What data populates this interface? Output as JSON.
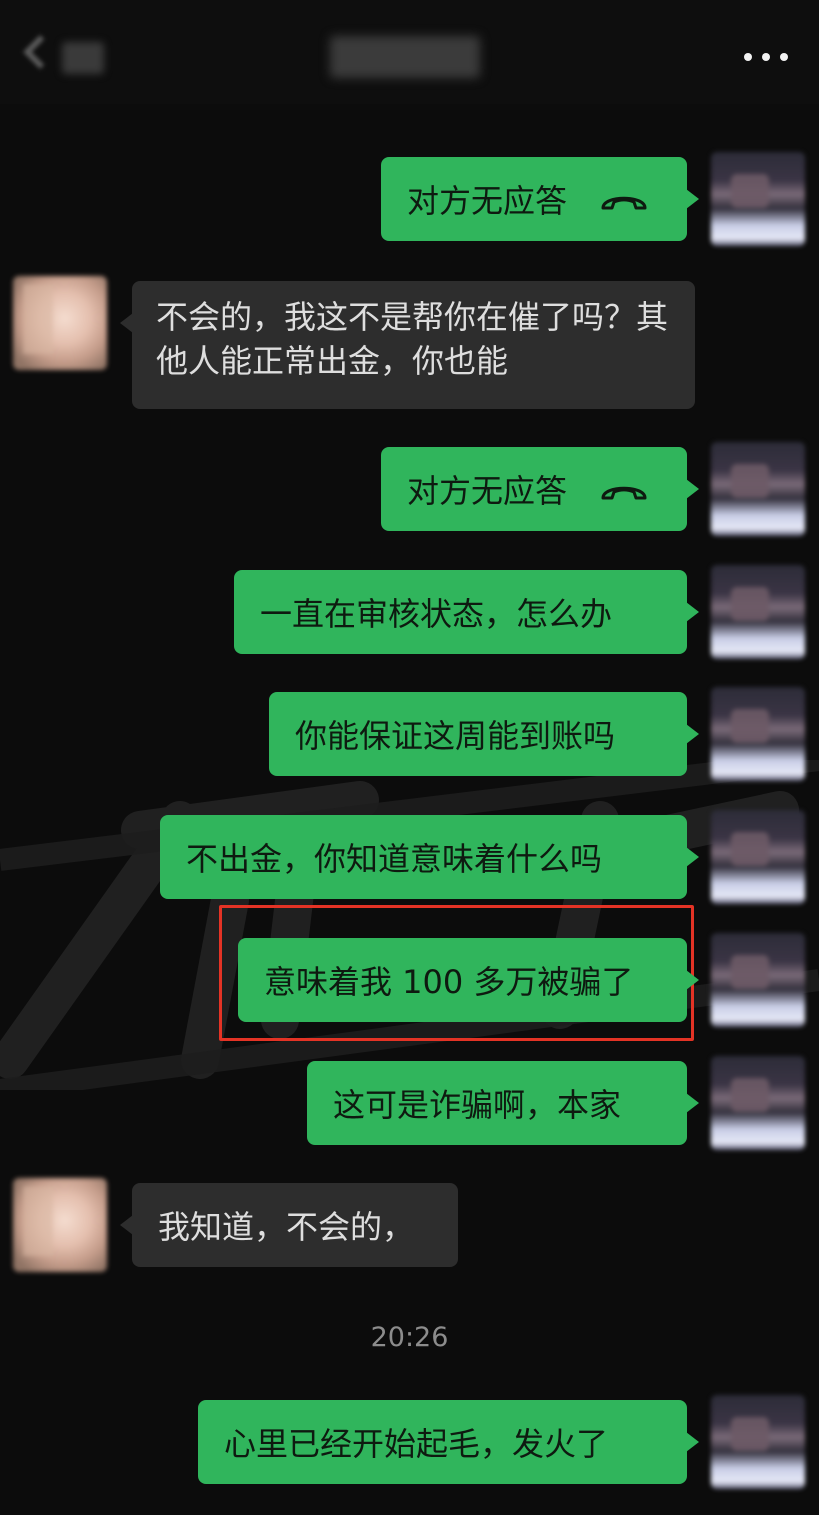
{
  "header": {
    "back_label": "<",
    "more_icon": "more-dots-icon"
  },
  "messages": [
    {
      "id": "m1",
      "side": "sent",
      "text": "对方无应答",
      "icon": "hang-up-phone-icon"
    },
    {
      "id": "m2",
      "side": "received",
      "text": "不会的，我这不是帮你在催了吗？其他人能正常出金，你也能"
    },
    {
      "id": "m3",
      "side": "sent",
      "text": "对方无应答",
      "icon": "hang-up-phone-icon"
    },
    {
      "id": "m4",
      "side": "sent",
      "text": "一直在审核状态，怎么办"
    },
    {
      "id": "m5",
      "side": "sent",
      "text": "你能保证这周能到账吗"
    },
    {
      "id": "m6",
      "side": "sent",
      "text": "不出金，你知道意味着什么吗"
    },
    {
      "id": "m7",
      "side": "sent",
      "text": "意味着我 100 多万被骗了",
      "highlighted": true
    },
    {
      "id": "m8",
      "side": "sent",
      "text": "这可是诈骗啊，本家"
    },
    {
      "id": "m9",
      "side": "received",
      "text": "我知道，不会的，"
    },
    {
      "id": "m10",
      "side": "sent",
      "text": "心里已经开始起毛，发火了"
    }
  ],
  "timestamp": "20:26",
  "colors": {
    "background": "#0c0c0c",
    "sent_bubble": "#30b55c",
    "received_bubble": "#2d2d2d",
    "highlight_border": "#e43325"
  }
}
